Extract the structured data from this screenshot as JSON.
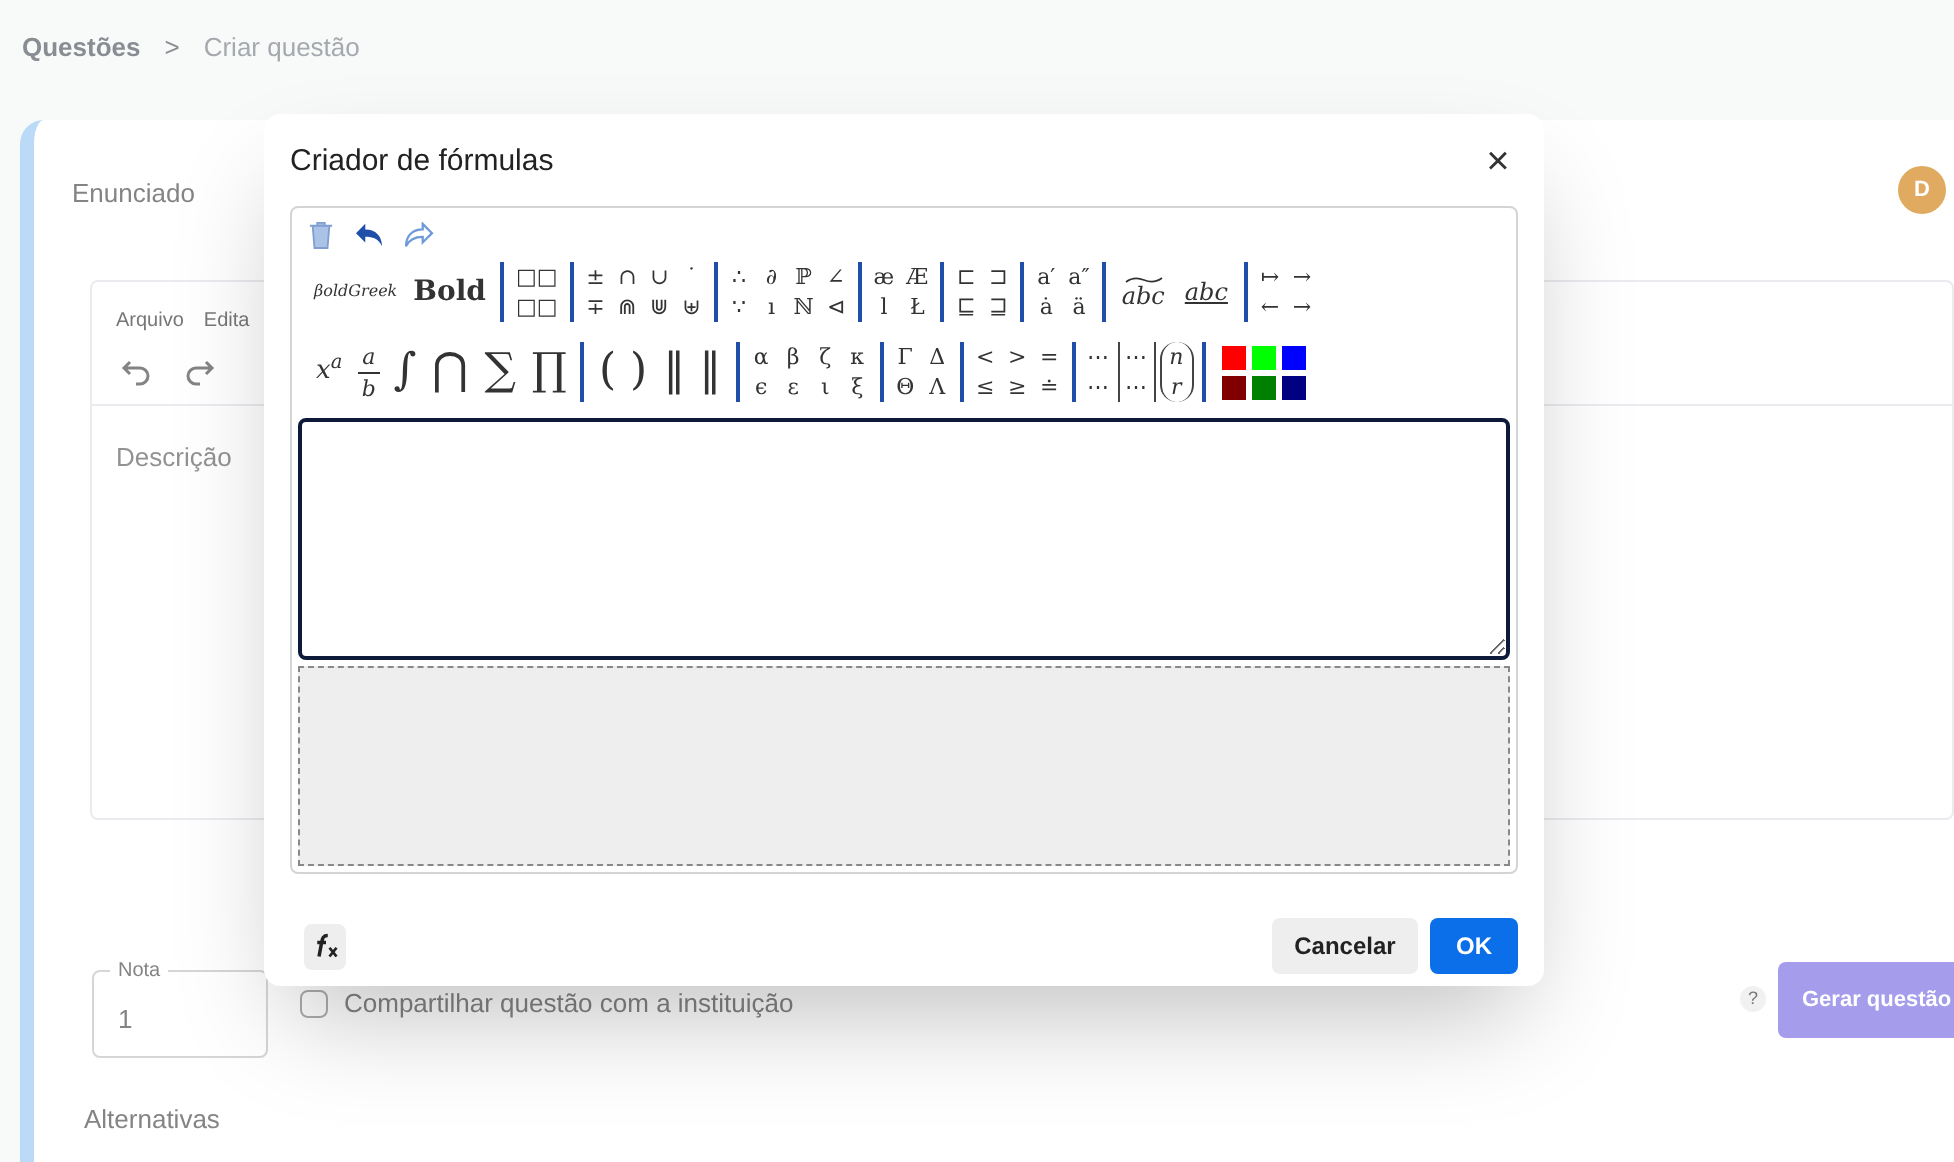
{
  "breadcrumb": [
    "Questões",
    ">",
    "Criar questão"
  ],
  "page": {
    "section_title": "Enunciado",
    "avatar": "D",
    "editor_menu": [
      "Arquivo",
      "Edita"
    ],
    "description_placeholder": "Descrição",
    "grade": {
      "label": "Nota",
      "value": "1"
    },
    "share": {
      "label": "Compartilhar questão com a instituição",
      "checked": false
    },
    "help": "?",
    "generate_button": "Gerar questão",
    "alternatives_title": "Alternativas"
  },
  "dialog": {
    "title": "Criador de fórmulas",
    "close": "×",
    "toolbar": [
      [
        {
          "items": [
            {
              "kind": "small",
              "label": "βoldGreek"
            },
            {
              "kind": "bold",
              "label": "Bold"
            }
          ]
        },
        {
          "items": [
            {
              "kind": "stack",
              "top": "□□",
              "bottom": "□□"
            }
          ]
        },
        {
          "items": [
            {
              "kind": "stack",
              "top": "±",
              "bottom": "∓"
            },
            {
              "kind": "stack",
              "top": "∩",
              "bottom": "⋒"
            },
            {
              "kind": "stack",
              "top": "∪",
              "bottom": "⋓"
            },
            {
              "kind": "stack",
              "top": "˙",
              "bottom": "⊎"
            }
          ]
        },
        {
          "items": [
            {
              "kind": "stack",
              "top": "∴",
              "bottom": "∵"
            },
            {
              "kind": "stack",
              "top": "∂",
              "bottom": "ı"
            },
            {
              "kind": "stack",
              "top": "ℙ",
              "bottom": "ℕ"
            },
            {
              "kind": "stack",
              "top": "∠",
              "bottom": "⊲"
            }
          ]
        },
        {
          "items": [
            {
              "kind": "stack",
              "top": "æ",
              "bottom": "l"
            },
            {
              "kind": "stack",
              "top": "Æ",
              "bottom": "Ł"
            }
          ]
        },
        {
          "items": [
            {
              "kind": "stack",
              "top": "⊏",
              "bottom": "⊑"
            },
            {
              "kind": "stack",
              "top": "⊐",
              "bottom": "⊒"
            }
          ]
        },
        {
          "items": [
            {
              "kind": "stack",
              "top": "a′",
              "bottom": "ȧ"
            },
            {
              "kind": "stack",
              "top": "a″",
              "bottom": "ä"
            }
          ]
        },
        {
          "items": [
            {
              "kind": "tilde",
              "label": "abc"
            },
            {
              "kind": "underline",
              "label": "abc"
            }
          ]
        },
        {
          "items": [
            {
              "kind": "stack",
              "top": "↦",
              "bottom": "←"
            },
            {
              "kind": "stack",
              "top": "→",
              "bottom": "→"
            }
          ]
        }
      ],
      [
        {
          "items": [
            {
              "kind": "rich",
              "label": "x$^{a}$"
            },
            {
              "kind": "fraction",
              "top": "a",
              "bottom": "b"
            },
            {
              "kind": "large",
              "label": "∫"
            },
            {
              "kind": "large",
              "label": "⋂"
            },
            {
              "kind": "large",
              "label": "∑"
            },
            {
              "kind": "large",
              "label": "∏"
            }
          ]
        },
        {
          "items": [
            {
              "kind": "large",
              "label": "( )"
            },
            {
              "kind": "large",
              "label": "‖ ‖"
            }
          ]
        },
        {
          "items": [
            {
              "kind": "stack",
              "top": "α",
              "bottom": "ϵ"
            },
            {
              "kind": "stack",
              "top": "β",
              "bottom": "ε"
            },
            {
              "kind": "stack",
              "top": "ζ",
              "bottom": "ι"
            },
            {
              "kind": "stack",
              "top": "κ",
              "bottom": "ξ"
            }
          ]
        },
        {
          "items": [
            {
              "kind": "stack",
              "top": "Γ",
              "bottom": "Θ"
            },
            {
              "kind": "stack",
              "top": "Δ",
              "bottom": "Λ"
            }
          ]
        },
        {
          "items": [
            {
              "kind": "stack",
              "top": "<",
              "bottom": "≤"
            },
            {
              "kind": "stack",
              "top": ">",
              "bottom": "≥"
            },
            {
              "kind": "stack",
              "top": "=",
              "bottom": "≐"
            }
          ]
        },
        {
          "items": [
            {
              "kind": "stack",
              "top": "⋯",
              "bottom": "⋯"
            },
            {
              "kind": "matrix",
              "top": "⋯",
              "bottom": "⋯"
            },
            {
              "kind": "binom",
              "top": "n",
              "bottom": "r"
            }
          ]
        },
        {
          "items": [
            {
              "kind": "swatch",
              "color": "#ff0000"
            },
            {
              "kind": "swatch",
              "color": "#800000"
            },
            {
              "kind": "swatch",
              "color": "#00ff00"
            },
            {
              "kind": "swatch",
              "color": "#008000"
            },
            {
              "kind": "swatch",
              "color": "#0000ff"
            },
            {
              "kind": "swatch",
              "color": "#000080"
            }
          ]
        }
      ]
    ],
    "buttons": [
      {
        "label": "Cancelar",
        "kind": "secondary"
      },
      {
        "label": "OK",
        "kind": "primary"
      }
    ]
  }
}
